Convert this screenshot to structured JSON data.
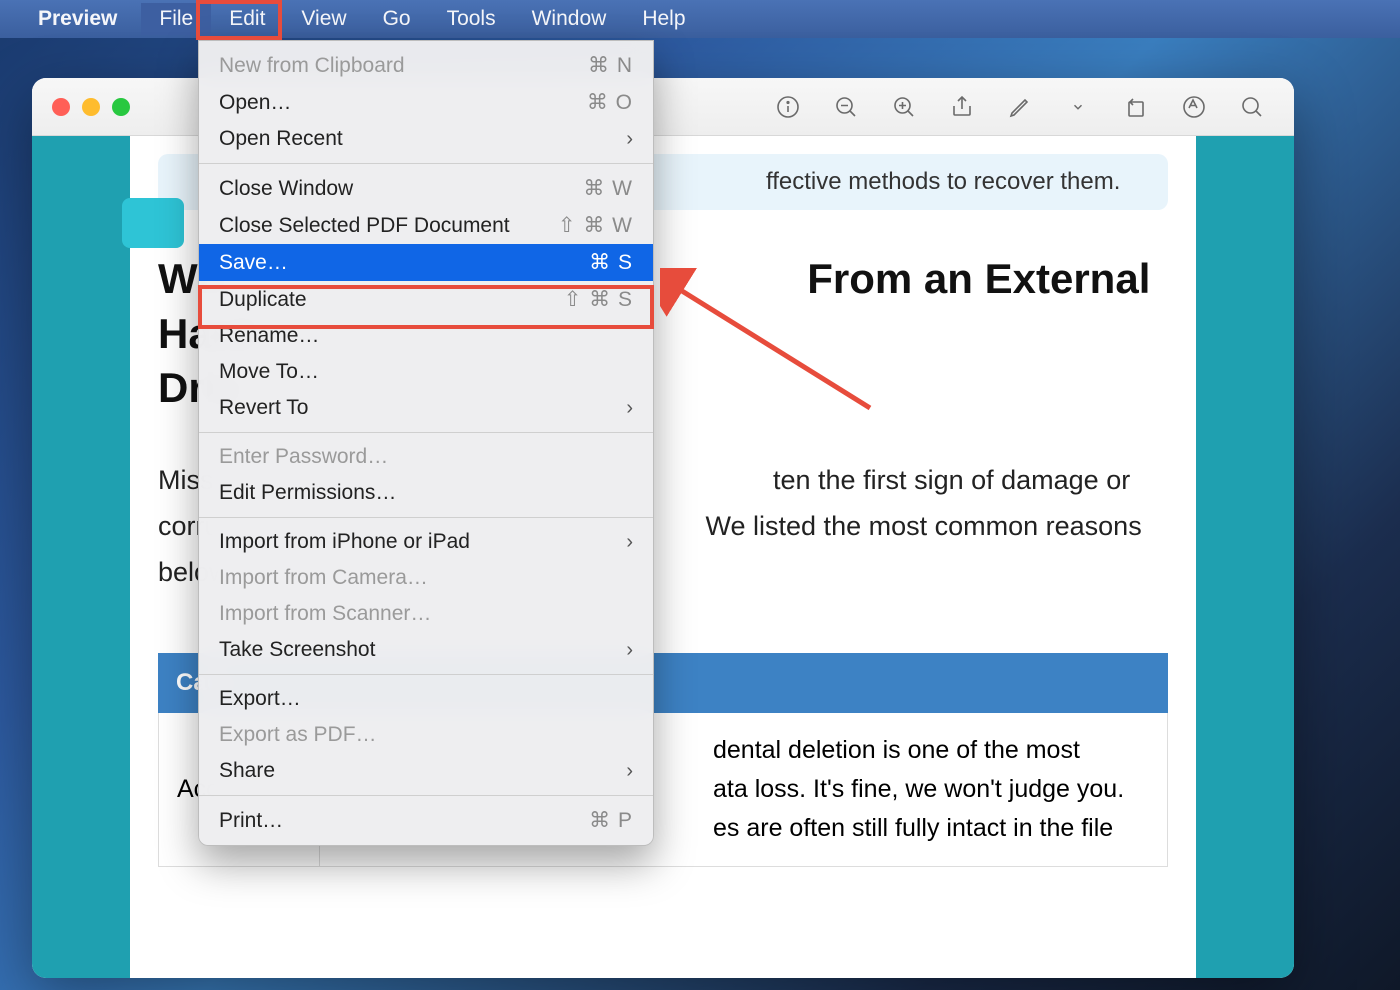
{
  "menubar": {
    "app": "Preview",
    "items": [
      "File",
      "Edit",
      "View",
      "Go",
      "Tools",
      "Window",
      "Help"
    ],
    "active": "File"
  },
  "toolbar": {
    "icons": [
      "info",
      "zoom-out",
      "zoom-in",
      "share",
      "markup",
      "dropdown",
      "rotate",
      "highlight",
      "search"
    ]
  },
  "dropdown": {
    "items": [
      {
        "label": "New from Clipboard",
        "shortcut": "⌘ N",
        "disabled": true
      },
      {
        "label": "Open…",
        "shortcut": "⌘ O"
      },
      {
        "label": "Open Recent",
        "submenu": true
      },
      {
        "sep": true
      },
      {
        "label": "Close Window",
        "shortcut": "⌘ W"
      },
      {
        "label": "Close Selected PDF Document",
        "shortcut": "⇧ ⌘ W"
      },
      {
        "label": "Save…",
        "shortcut": "⌘ S",
        "selected": true
      },
      {
        "label": "Duplicate",
        "shortcut": "⇧ ⌘ S"
      },
      {
        "label": "Rename…"
      },
      {
        "label": "Move To…"
      },
      {
        "label": "Revert To",
        "submenu": true
      },
      {
        "sep": true
      },
      {
        "label": "Enter Password…",
        "disabled": true
      },
      {
        "label": "Edit Permissions…"
      },
      {
        "sep": true
      },
      {
        "label": "Import from iPhone or iPad",
        "submenu": true
      },
      {
        "label": "Import from Camera…",
        "disabled": true
      },
      {
        "label": "Import from Scanner…",
        "disabled": true
      },
      {
        "label": "Take Screenshot",
        "submenu": true
      },
      {
        "sep": true
      },
      {
        "label": "Export…"
      },
      {
        "label": "Export as PDF…",
        "disabled": true
      },
      {
        "label": "Share",
        "submenu": true
      },
      {
        "sep": true
      },
      {
        "label": "Print…",
        "shortcut": "⌘ P"
      }
    ]
  },
  "document": {
    "info_tail": "ffective methods to recover them.",
    "title_prefix": "Wh",
    "title_mid": "From an External Hard",
    "title_line2_prefix": "Driv",
    "para_prefix": "Missi",
    "para_mid": "ten the first sign of damage or",
    "para_line2_prefix": "corru",
    "para_line2_mid": "We listed the most common reasons",
    "para_line3_prefix": "below",
    "table_header": "Caus",
    "row_label": "Acci",
    "row_body_l1": "dental deletion is one of the most",
    "row_body_l2": "ata loss. It's fine, we won't judge you.",
    "row_body_l3": "es are often still fully intact in the file"
  }
}
